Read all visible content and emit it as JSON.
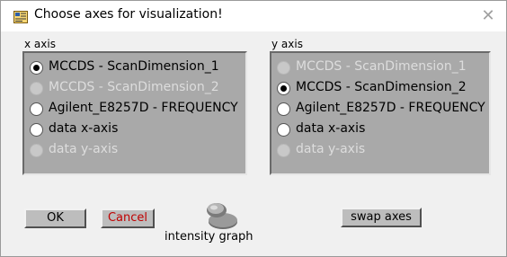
{
  "window": {
    "title": "Choose axes for visualization!",
    "close_glyph": "✕"
  },
  "x_axis": {
    "label": "x axis",
    "options": [
      {
        "label": "MCCDS - ScanDimension_1",
        "selected": true,
        "disabled": false
      },
      {
        "label": "MCCDS - ScanDimension_2",
        "selected": false,
        "disabled": true
      },
      {
        "label": "Agilent_E8257D - FREQUENCY",
        "selected": false,
        "disabled": false
      },
      {
        "label": "data x-axis",
        "selected": false,
        "disabled": false
      },
      {
        "label": "data y-axis",
        "selected": false,
        "disabled": true
      }
    ]
  },
  "y_axis": {
    "label": "y axis",
    "options": [
      {
        "label": "MCCDS - ScanDimension_1",
        "selected": false,
        "disabled": true
      },
      {
        "label": "MCCDS - ScanDimension_2",
        "selected": true,
        "disabled": false
      },
      {
        "label": "Agilent_E8257D - FREQUENCY",
        "selected": false,
        "disabled": false
      },
      {
        "label": "data x-axis",
        "selected": false,
        "disabled": false
      },
      {
        "label": "data y-axis",
        "selected": false,
        "disabled": true
      }
    ]
  },
  "buttons": {
    "ok_label": "OK",
    "cancel_label": "Cancel",
    "swap_label": "swap axes"
  },
  "toggle": {
    "label": "intensity graph"
  },
  "colors": {
    "cancel_text": "#c00000",
    "group_bg": "#a9a9a9"
  }
}
